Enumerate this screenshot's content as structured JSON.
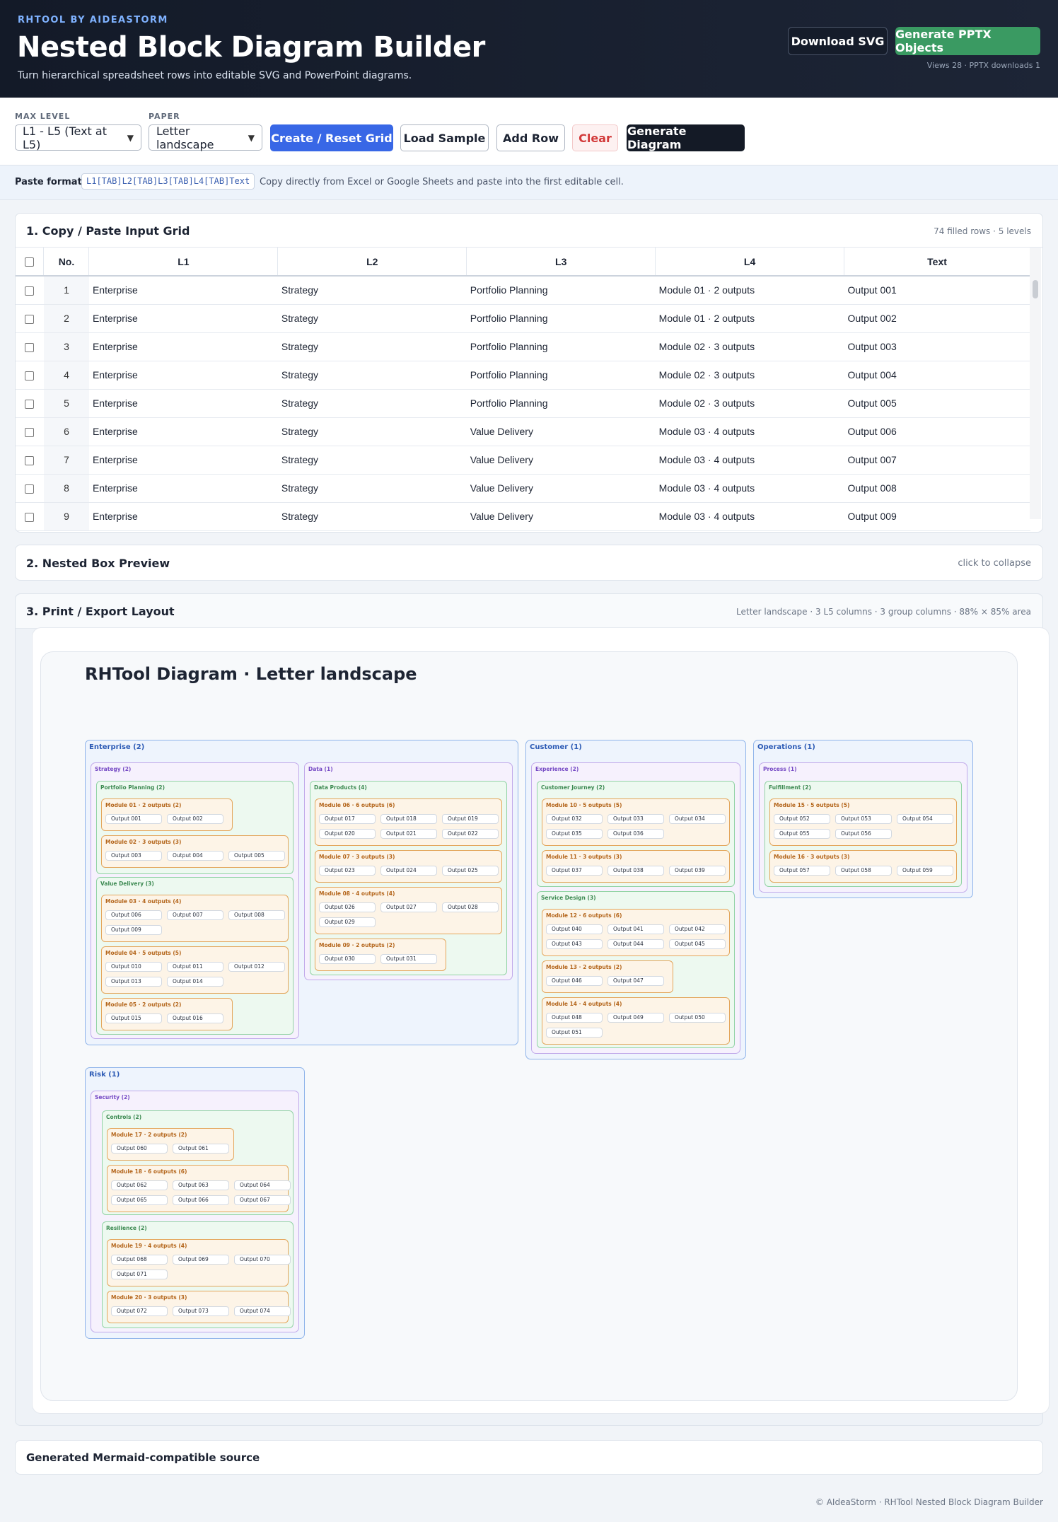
{
  "header": {
    "brand": "RHTOOL BY AIDEASTORM",
    "title": "Nested Block Diagram Builder",
    "subtitle": "Turn hierarchical spreadsheet rows into editable SVG and PowerPoint diagrams.",
    "download_svg": "Download SVG",
    "generate_pptx": "Generate PPTX Objects",
    "stats": "Views 28  ·  PPTX downloads 1"
  },
  "toolbar": {
    "max_level_label": "MAX LEVEL",
    "max_level_value": "L1 - L5 (Text at L5)",
    "paper_label": "PAPER",
    "paper_value": "Letter landscape",
    "create_reset": "Create / Reset Grid",
    "load_sample": "Load Sample",
    "add_row": "Add Row",
    "clear": "Clear",
    "generate": "Generate Diagram"
  },
  "paste": {
    "label": "Paste format:",
    "format": "L1[TAB]L2[TAB]L3[TAB]L4[TAB]Text",
    "hint": "Copy directly from Excel or Google Sheets and paste into the first editable cell."
  },
  "grid_section": {
    "title": "1. Copy / Paste Input Grid",
    "meta": "74 filled rows · 5 levels",
    "columns": [
      "No.",
      "L1",
      "L2",
      "L3",
      "L4",
      "Text"
    ],
    "rows": [
      [
        "1",
        "Enterprise",
        "Strategy",
        "Portfolio Planning",
        "Module 01 · 2 outputs",
        "Output 001"
      ],
      [
        "2",
        "Enterprise",
        "Strategy",
        "Portfolio Planning",
        "Module 01 · 2 outputs",
        "Output 002"
      ],
      [
        "3",
        "Enterprise",
        "Strategy",
        "Portfolio Planning",
        "Module 02 · 3 outputs",
        "Output 003"
      ],
      [
        "4",
        "Enterprise",
        "Strategy",
        "Portfolio Planning",
        "Module 02 · 3 outputs",
        "Output 004"
      ],
      [
        "5",
        "Enterprise",
        "Strategy",
        "Portfolio Planning",
        "Module 02 · 3 outputs",
        "Output 005"
      ],
      [
        "6",
        "Enterprise",
        "Strategy",
        "Value Delivery",
        "Module 03 · 4 outputs",
        "Output 006"
      ],
      [
        "7",
        "Enterprise",
        "Strategy",
        "Value Delivery",
        "Module 03 · 4 outputs",
        "Output 007"
      ],
      [
        "8",
        "Enterprise",
        "Strategy",
        "Value Delivery",
        "Module 03 · 4 outputs",
        "Output 008"
      ],
      [
        "9",
        "Enterprise",
        "Strategy",
        "Value Delivery",
        "Module 03 · 4 outputs",
        "Output 009"
      ]
    ]
  },
  "preview_section": {
    "title": "2. Nested Box Preview",
    "meta": "click to collapse"
  },
  "layout_section": {
    "title": "3. Print / Export Layout",
    "meta": "Letter landscape · 3 L5 columns · 3 group columns · 88% × 85% area",
    "sheet_title": "RHTool Diagram · Letter landscape"
  },
  "diagram": {
    "l1": [
      {
        "label": "Enterprise (2)",
        "l2": [
          {
            "label": "Strategy (2)",
            "l3": [
              {
                "label": "Portfolio Planning (2)",
                "l4": [
                  {
                    "label": "Module 01 · 2 outputs (2)",
                    "items": [
                      "Output 001",
                      "Output 002"
                    ]
                  },
                  {
                    "label": "Module 02 · 3 outputs (3)",
                    "items": [
                      "Output 003",
                      "Output 004",
                      "Output 005"
                    ]
                  }
                ]
              },
              {
                "label": "Value Delivery (3)",
                "l4": [
                  {
                    "label": "Module 03 · 4 outputs (4)",
                    "items": [
                      "Output 006",
                      "Output 007",
                      "Output 008",
                      "Output 009"
                    ]
                  },
                  {
                    "label": "Module 04 · 5 outputs (5)",
                    "items": [
                      "Output 010",
                      "Output 011",
                      "Output 012",
                      "Output 013",
                      "Output 014"
                    ]
                  },
                  {
                    "label": "Module 05 · 2 outputs (2)",
                    "items": [
                      "Output 015",
                      "Output 016"
                    ]
                  }
                ]
              }
            ]
          },
          {
            "label": "Data (1)",
            "l3": [
              {
                "label": "Data Products (4)",
                "l4": [
                  {
                    "label": "Module 06 · 6 outputs (6)",
                    "items": [
                      "Output 017",
                      "Output 018",
                      "Output 019",
                      "Output 020",
                      "Output 021",
                      "Output 022"
                    ]
                  },
                  {
                    "label": "Module 07 · 3 outputs (3)",
                    "items": [
                      "Output 023",
                      "Output 024",
                      "Output 025"
                    ]
                  },
                  {
                    "label": "Module 08 · 4 outputs (4)",
                    "items": [
                      "Output 026",
                      "Output 027",
                      "Output 028",
                      "Output 029"
                    ]
                  },
                  {
                    "label": "Module 09 · 2 outputs (2)",
                    "items": [
                      "Output 030",
                      "Output 031"
                    ]
                  }
                ]
              }
            ]
          }
        ]
      },
      {
        "label": "Customer (1)",
        "l2": [
          {
            "label": "Experience (2)",
            "l3": [
              {
                "label": "Customer Journey (2)",
                "l4": [
                  {
                    "label": "Module 10 · 5 outputs (5)",
                    "items": [
                      "Output 032",
                      "Output 033",
                      "Output 034",
                      "Output 035",
                      "Output 036"
                    ]
                  },
                  {
                    "label": "Module 11 · 3 outputs (3)",
                    "items": [
                      "Output 037",
                      "Output 038",
                      "Output 039"
                    ]
                  }
                ]
              },
              {
                "label": "Service Design (3)",
                "l4": [
                  {
                    "label": "Module 12 · 6 outputs (6)",
                    "items": [
                      "Output 040",
                      "Output 041",
                      "Output 042",
                      "Output 043",
                      "Output 044",
                      "Output 045"
                    ]
                  },
                  {
                    "label": "Module 13 · 2 outputs (2)",
                    "items": [
                      "Output 046",
                      "Output 047"
                    ]
                  },
                  {
                    "label": "Module 14 · 4 outputs (4)",
                    "items": [
                      "Output 048",
                      "Output 049",
                      "Output 050",
                      "Output 051"
                    ]
                  }
                ]
              }
            ]
          }
        ]
      },
      {
        "label": "Operations (1)",
        "l2": [
          {
            "label": "Process (1)",
            "l3": [
              {
                "label": "Fulfillment (2)",
                "l4": [
                  {
                    "label": "Module 15 · 5 outputs (5)",
                    "items": [
                      "Output 052",
                      "Output 053",
                      "Output 054",
                      "Output 055",
                      "Output 056"
                    ]
                  },
                  {
                    "label": "Module 16 · 3 outputs (3)",
                    "items": [
                      "Output 057",
                      "Output 058",
                      "Output 059"
                    ]
                  }
                ]
              }
            ]
          }
        ]
      },
      {
        "label": "Risk (1)",
        "l2": [
          {
            "label": "Security (2)",
            "l3": [
              {
                "label": "Controls (2)",
                "l4": [
                  {
                    "label": "Module 17 · 2 outputs (2)",
                    "items": [
                      "Output 060",
                      "Output 061"
                    ]
                  },
                  {
                    "label": "Module 18 · 6 outputs (6)",
                    "items": [
                      "Output 062",
                      "Output 063",
                      "Output 064",
                      "Output 065",
                      "Output 066",
                      "Output 067"
                    ]
                  }
                ]
              },
              {
                "label": "Resilience (2)",
                "l4": [
                  {
                    "label": "Module 19 · 4 outputs (4)",
                    "items": [
                      "Output 068",
                      "Output 069",
                      "Output 070",
                      "Output 071"
                    ]
                  },
                  {
                    "label": "Module 20 · 3 outputs (3)",
                    "items": [
                      "Output 072",
                      "Output 073",
                      "Output 074"
                    ]
                  }
                ]
              }
            ]
          }
        ]
      }
    ]
  },
  "mermaid_section": {
    "title": "Generated Mermaid-compatible source"
  },
  "footer": "© AIdeaStorm · RHTool Nested Block Diagram Builder"
}
